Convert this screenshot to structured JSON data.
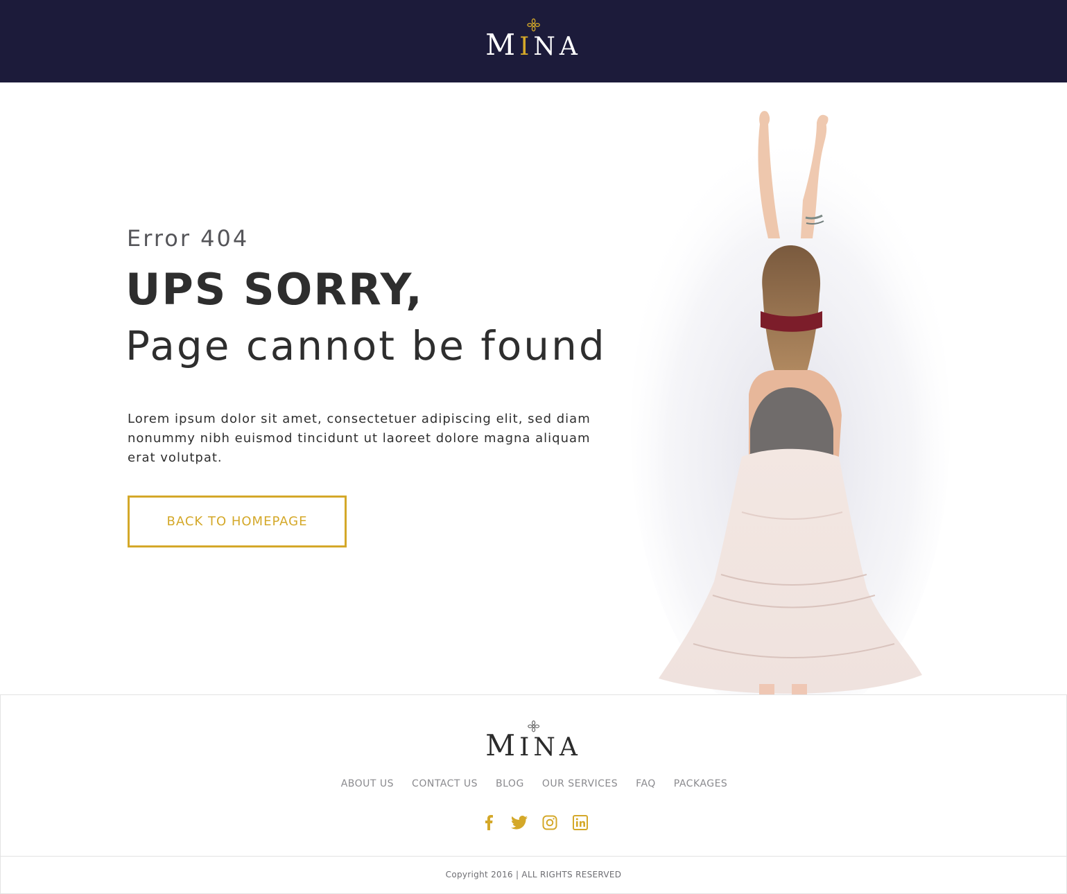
{
  "header": {
    "logo": {
      "first": "M",
      "accent": "I",
      "rest": "NA"
    }
  },
  "hero": {
    "error_code": "Error 404",
    "headline": "UPS SORRY,",
    "subhead": "Page cannot be found",
    "body": "Lorem ipsum dolor sit amet, consectetuer adipiscing elit, sed diam nonummy nibh euismod tincidunt ut laoreet dolore magna aliquam erat volutpat.",
    "button_label": "BACK TO HOMEPAGE"
  },
  "footer": {
    "logo": {
      "first": "M",
      "rest": "INA"
    },
    "nav": [
      {
        "label": "ABOUT US"
      },
      {
        "label": "CONTACT US"
      },
      {
        "label": "BLOG"
      },
      {
        "label": "OUR SERVICES"
      },
      {
        "label": "FAQ"
      },
      {
        "label": "PACKAGES"
      }
    ],
    "social": [
      {
        "icon": "facebook-icon"
      },
      {
        "icon": "twitter-icon"
      },
      {
        "icon": "instagram-icon"
      },
      {
        "icon": "linkedin-icon"
      }
    ],
    "copyright": "Copyright 2016 | ALL RIGHTS RESERVED"
  },
  "colors": {
    "header_bg": "#1c1b3a",
    "accent": "#d4a829",
    "text_dark": "#2e2e2e"
  }
}
